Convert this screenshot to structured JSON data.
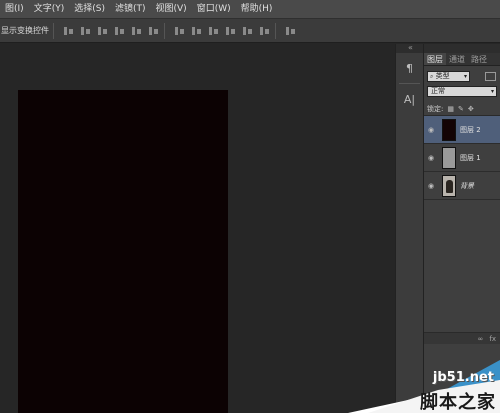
{
  "menubar": {
    "items": [
      "图(I)",
      "文字(Y)",
      "选择(S)",
      "滤镜(T)",
      "视图(V)",
      "窗口(W)",
      "帮助(H)"
    ]
  },
  "options": {
    "label": "显示变换控件"
  },
  "tools": {
    "para_label": "¶",
    "char_label": "A|"
  },
  "layers_panel": {
    "tabs": [
      "图层",
      "通道",
      "路径"
    ],
    "filter_label": "类型",
    "blend_mode": "正常",
    "lock_label": "锁定:",
    "layers": [
      {
        "name": "图层 2",
        "selected": true,
        "thumb": "dark"
      },
      {
        "name": "图层 1",
        "selected": false,
        "thumb": "gray"
      },
      {
        "name": "背景",
        "selected": false,
        "thumb": "photo"
      }
    ],
    "bottom_icons": [
      "∞",
      "fx"
    ]
  },
  "watermark": {
    "url": "jb51.net",
    "text": "脚本之家"
  },
  "colors": {
    "document_fill": "#0c0203",
    "selected_layer": "#4f5f7a"
  }
}
